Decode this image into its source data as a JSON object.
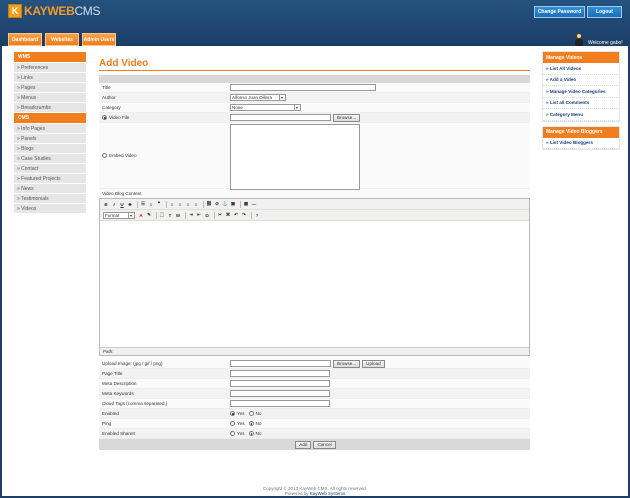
{
  "brand": {
    "name_orange": "KAYWEB",
    "name_white": "CMS",
    "mark": "K"
  },
  "header": {
    "change_password": "Change Password",
    "logout": "Logout",
    "tabs": [
      "Dashboard",
      "Websites",
      "Admin Users"
    ],
    "welcome": "Welcome gabo!"
  },
  "sidebar": {
    "wms_title": "WMS",
    "wms_items": [
      "» Preferences",
      "» Links",
      "» Pages",
      "» Menus",
      "» Breadcrumbs"
    ],
    "cms_title": "CMS",
    "cms_items": [
      "» Info Pages",
      "» Panels",
      "» Blogs",
      "» Case Studies",
      "» Contact",
      "» Featured Projects",
      "» News",
      "» Testimonials",
      "» Videos"
    ]
  },
  "right": {
    "videos_title": "Manage Videos",
    "videos_items": [
      "» List All Videos",
      "» Add a Video",
      "» Manage Video Categories",
      "» List all Comments",
      "» Category Menu"
    ],
    "bloggers_title": "Manage Video Bloggers",
    "bloggers_items": [
      "» List Video Bloggers"
    ]
  },
  "form": {
    "page_title": "Add Video",
    "title_label": "Title",
    "author_label": "Author",
    "author_value": "Alfonso Juan Dillera",
    "category_label": "Category",
    "category_value": "None",
    "video_file_label": "Video File",
    "browse": "Browse...",
    "embed_label": "Embed Video",
    "content_label": "Video Blog Content",
    "format_value": "Format",
    "path_label": "Path:",
    "upload_image_label": "Upload Image: (jpg / gif / png)",
    "upload": "Upload",
    "page_title_label": "Page Title",
    "meta_desc_label": "Meta Description",
    "meta_keywords_label": "Meta Keywords",
    "cloud_tags_label": "Cloud Tags (comma separated.)",
    "enabled_label": "Enabled",
    "ping_label": "Ping",
    "sharelt_label": "Enabled ShareIt",
    "yes": "Yes",
    "no": "No",
    "add": "Add",
    "cancel": "Cancel"
  },
  "footer": {
    "copyright": "Copyright © 2013 KayWeb CMS. All rights reserved.",
    "powered_prefix": "Powered by ",
    "powered_link": "KayWeb Systems"
  }
}
